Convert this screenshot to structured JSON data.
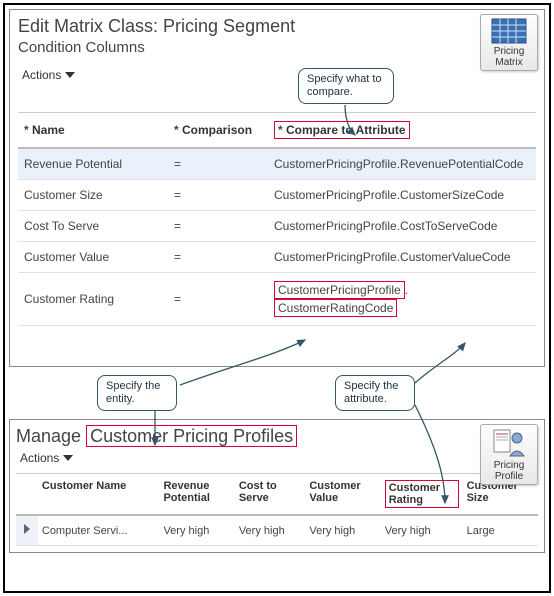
{
  "top": {
    "title": "Edit Matrix Class: Pricing Segment",
    "subtitle": "Condition Columns",
    "icon_label": "Pricing Matrix",
    "actions_label": "Actions",
    "callout_compare": "Specify what to compare.",
    "callout_entity": "Specify the entity.",
    "callout_attr": "Specify the attribute.",
    "headers": {
      "name": "Name",
      "comparison": "Comparison",
      "compare_to": "Compare to Attribute"
    },
    "rows": [
      {
        "name": "Revenue Potential",
        "comp": "=",
        "attr": "CustomerPricingProfile.RevenuePotentialCode"
      },
      {
        "name": "Customer Size",
        "comp": "=",
        "attr": "CustomerPricingProfile.CustomerSizeCode"
      },
      {
        "name": "Cost To Serve",
        "comp": "=",
        "attr": "CustomerPricingProfile.CostToServeCode"
      },
      {
        "name": "Customer Value",
        "comp": "=",
        "attr": "CustomerPricingProfile.CustomerValueCode"
      }
    ],
    "row_last": {
      "name": "Customer Rating",
      "comp": "=",
      "attr_entity": "CustomerPricingProfile",
      "attr_dot": ".",
      "attr_field": "CustomerRatingCode"
    }
  },
  "bottom": {
    "title_prefix": "Manage",
    "title_emph": "Customer Pricing Profiles",
    "icon_label": "Pricing Profile",
    "actions_label": "Actions",
    "headers": {
      "blank": "",
      "cust": "Customer Name",
      "rev": "Revenue Potential",
      "cost": "Cost to Serve",
      "val": "Customer Value",
      "rating": "Customer Rating",
      "size": "Customer Size"
    },
    "row": {
      "cust": "Computer Servi...",
      "rev": "Very high",
      "cost": "Very high",
      "val": "Very high",
      "rating": "Very high",
      "size": "Large"
    }
  }
}
